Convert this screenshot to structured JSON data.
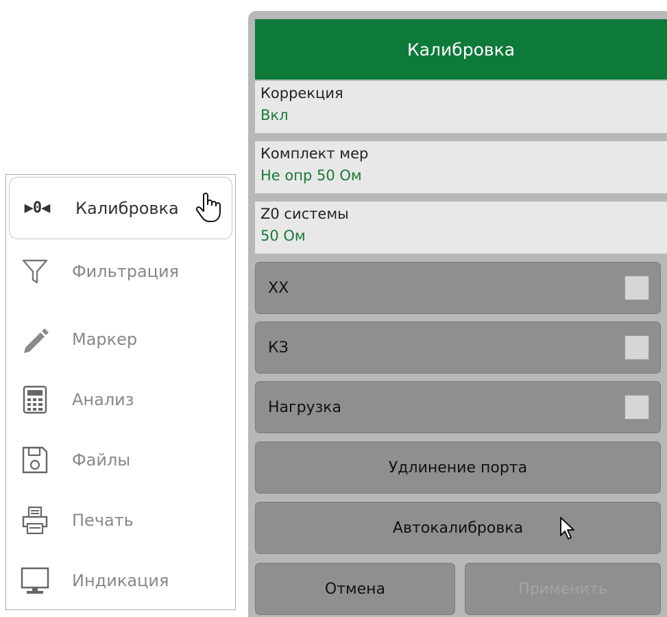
{
  "left_menu": {
    "items": [
      {
        "label": "Калибровка",
        "icon": "calibration-icon",
        "active": true
      },
      {
        "label": "Фильтрация",
        "icon": "filter-icon"
      },
      {
        "label": "Маркер",
        "icon": "pencil-icon"
      },
      {
        "label": "Анализ",
        "icon": "calculator-icon"
      },
      {
        "label": "Файлы",
        "icon": "floppy-disk-icon"
      },
      {
        "label": "Печать",
        "icon": "printer-icon"
      },
      {
        "label": "Индикация",
        "icon": "monitor-icon"
      }
    ],
    "active_glyph": "▶0◀"
  },
  "panel": {
    "title": "Калибровка",
    "rows": [
      {
        "label": "Коррекция",
        "value": "Вкл"
      },
      {
        "label": "Комплект мер",
        "value": "Не опр 50 Ом"
      },
      {
        "label": "Z0 системы",
        "value": "50 Ом"
      }
    ],
    "check_buttons": [
      {
        "label": "ХХ",
        "checked": false
      },
      {
        "label": "КЗ",
        "checked": false
      },
      {
        "label": "Нагрузка",
        "checked": false
      }
    ],
    "port_extension_label": "Удлинение порта",
    "autocal_label": "Автокалибровка",
    "cancel_label": "Отмена",
    "apply_label": "Применить"
  },
  "colors": {
    "header_bg": "#0e7a3a",
    "value_text": "#1a7a36",
    "button_bg": "#8f8f8f",
    "disabled_text": "#a4a4a4"
  }
}
